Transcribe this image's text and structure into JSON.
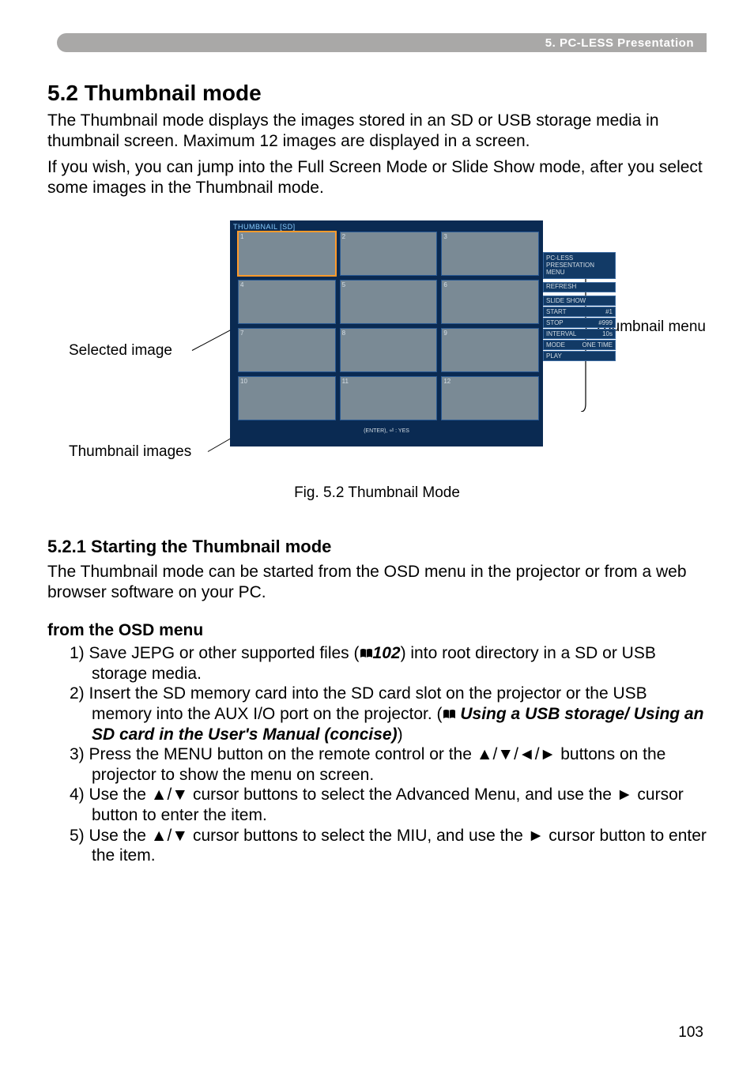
{
  "section_bar": "5. PC-LESS Presentation",
  "title": "5.2 Thumbnail mode",
  "intro_p1": "The Thumbnail mode displays the images stored in an SD or USB storage media in thumbnail screen.  Maximum 12 images are displayed in a screen.",
  "intro_p2": "If you wish, you can jump into the Full Screen Mode or Slide Show mode, after you select some images in the Thumbnail mode.",
  "figure": {
    "selected_label": "Selected image",
    "thumbnail_label": "Thumbnail images",
    "menu_label": "Thumbnail menu",
    "caption": "Fig. 5.2 Thumbnail Mode",
    "screen_header": "THUMBNAIL  [SD]",
    "footer": "(ENTER), ⏎ : YES",
    "cells": [
      "1",
      "2",
      "3",
      "4",
      "5",
      "6",
      "7",
      "8",
      "9",
      "10",
      "11",
      "12"
    ],
    "side": {
      "pcless": "PC-LESS\nPRESENTATION\nMENU",
      "refresh": "REFRESH",
      "slideshow": "SLIDE SHOW",
      "start_l": "START",
      "start_v": "#1",
      "stop_l": "STOP",
      "stop_v": "#999",
      "interval_l": "INTERVAL",
      "interval_v": "10s",
      "mode_l": "MODE",
      "mode_v": "ONE TIME",
      "play": "PLAY"
    }
  },
  "subheading": "5.2.1 Starting the Thumbnail mode",
  "sub_body": "The Thumbnail mode can be started from the OSD menu in the projector or from a web browser software on your PC.",
  "from_heading": "from the OSD menu",
  "steps": {
    "s1a": "1) Save JEPG or other supported files (",
    "s1_ref": "102",
    "s1b": ") into root directory in a SD or USB storage media.",
    "s2a": "2) Insert the SD memory card into the SD card slot on the projector or the USB memory into the AUX I/O port on the projector. (",
    "s2_ref": " Using a USB storage/ Using an SD card in the User's Manual (concise)",
    "s2b": ")",
    "s3": "3) Press the MENU button on the remote control or the ▲/▼/◄/► buttons on the projector to show the menu on screen.",
    "s4": "4) Use the ▲/▼ cursor buttons to select the Advanced Menu, and use the ► cursor button to enter the item.",
    "s5": "5) Use the ▲/▼ cursor buttons to select the MIU, and use the ► cursor button to enter the item."
  },
  "page_number": "103"
}
